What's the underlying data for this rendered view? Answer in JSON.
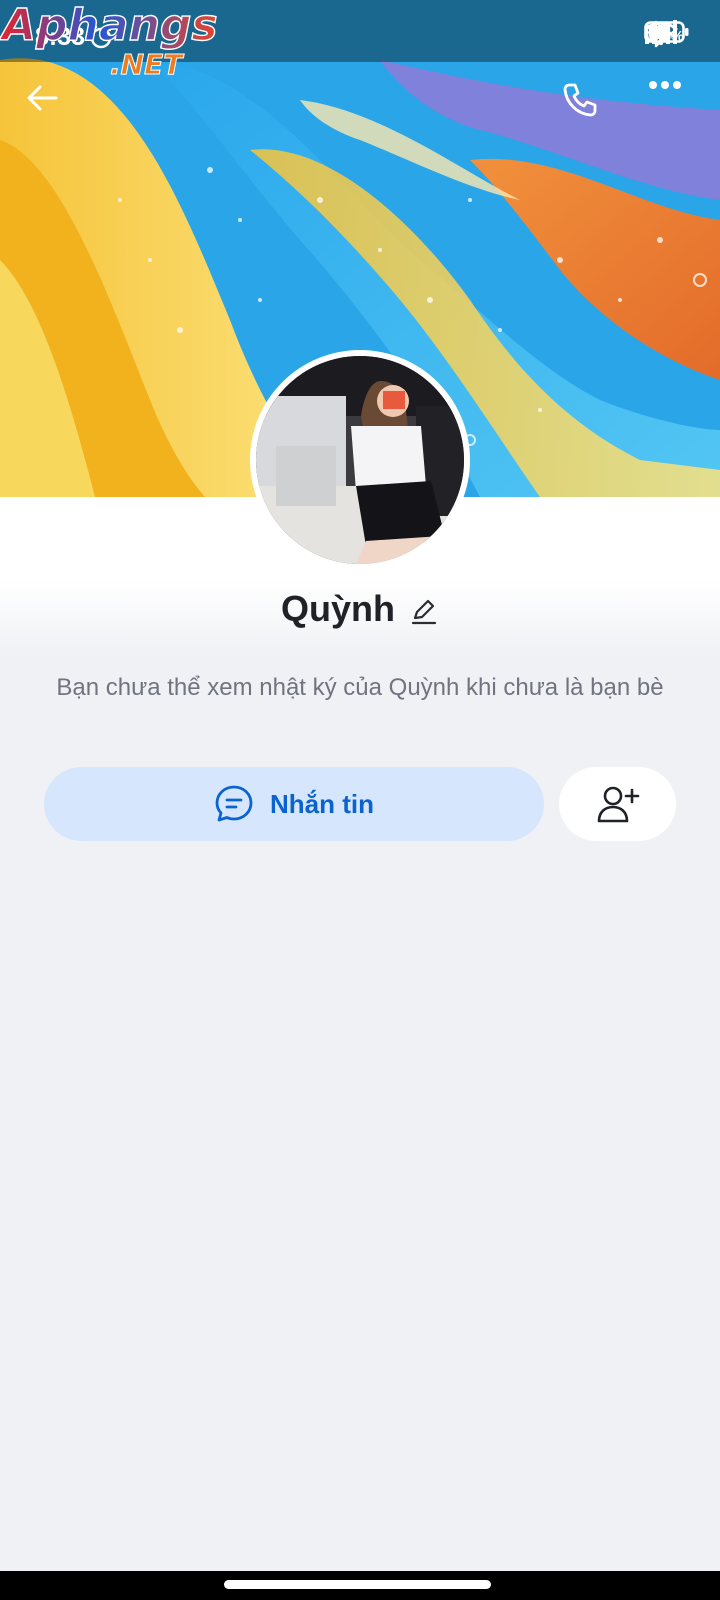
{
  "status_bar": {
    "time": "8:33",
    "battery_percent": "68",
    "battery_unit": "%",
    "battery_level": 0.68
  },
  "header": {
    "watermark_text": "Aphangs .NET"
  },
  "profile": {
    "name": "Quỳnh",
    "notice": "Bạn chưa thể xem nhật ký của Quỳnh khi chưa là bạn bè"
  },
  "actions": {
    "message_label": "Nhắn tin"
  },
  "colors": {
    "accent": "#0b63cf",
    "message_button_bg": "#d6e7fd",
    "page_bg": "#f0f1f5"
  },
  "icons": {
    "back": "arrow-left",
    "call": "phone",
    "more": "dots-horizontal",
    "edit": "pencil",
    "message": "chat-bubble",
    "add_friend": "user-plus",
    "alarm": "alarm-clock",
    "bluetooth": "bluetooth",
    "wifi": "wifi"
  }
}
